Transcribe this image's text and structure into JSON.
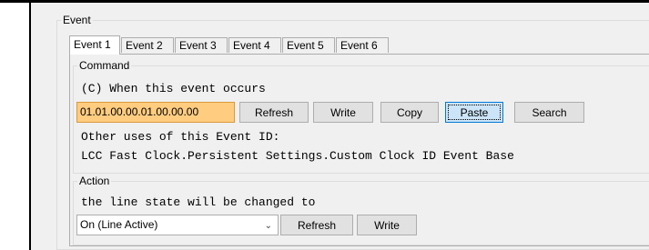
{
  "event_group": {
    "legend": "Event"
  },
  "tabs": [
    {
      "label": "Event 1",
      "active": true
    },
    {
      "label": "Event 2",
      "active": false
    },
    {
      "label": "Event 3",
      "active": false
    },
    {
      "label": "Event 4",
      "active": false
    },
    {
      "label": "Event 5",
      "active": false
    },
    {
      "label": "Event 6",
      "active": false
    }
  ],
  "command": {
    "legend": "Command",
    "description": "(C) When this event occurs",
    "event_id": "01.01.00.00.01.00.00.00",
    "buttons": {
      "refresh": "Refresh",
      "write": "Write",
      "copy": "Copy",
      "paste": "Paste",
      "search": "Search"
    },
    "other_uses_label": "Other uses of this Event ID:",
    "other_uses_value": "LCC Fast Clock.Persistent Settings.Custom Clock ID Event Base"
  },
  "action": {
    "legend": "Action",
    "description": "the line state will be changed to",
    "selected_option": "On (Line Active)",
    "buttons": {
      "refresh": "Refresh",
      "write": "Write"
    }
  },
  "colors": {
    "event_id_background": "#ffcc80",
    "focused_button": "#cce4f7"
  },
  "icons": {
    "dropdown": "chevron-down-icon"
  }
}
